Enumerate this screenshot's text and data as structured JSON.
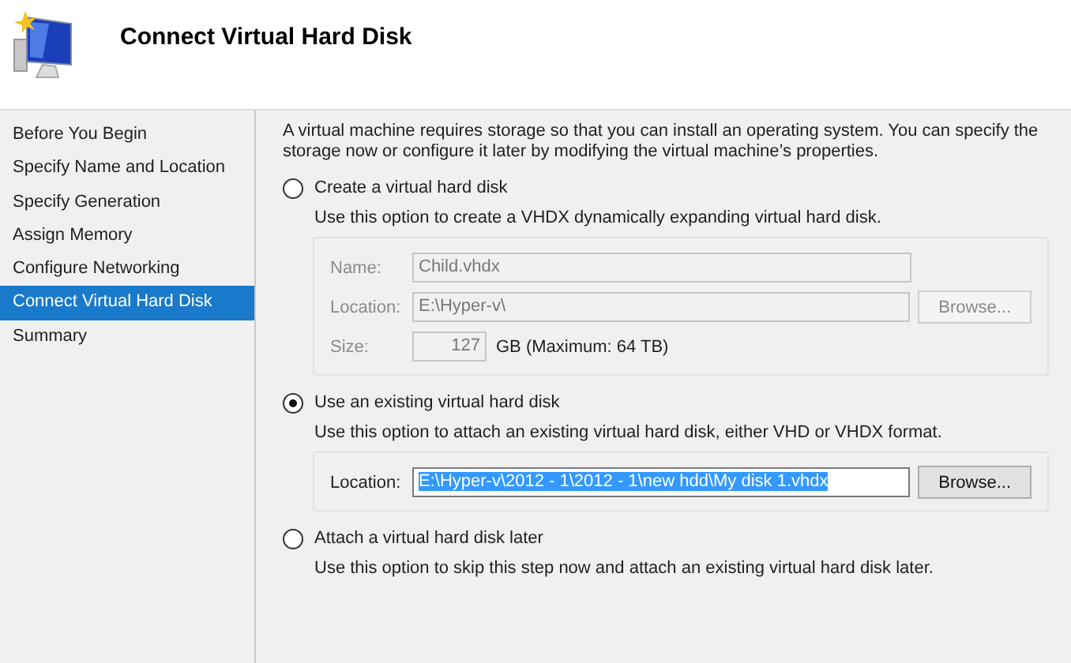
{
  "header": {
    "title": "Connect Virtual Hard Disk"
  },
  "sidebar": {
    "items": [
      {
        "label": "Before You Begin",
        "selected": false
      },
      {
        "label": "Specify Name and Location",
        "selected": false
      },
      {
        "label": "Specify Generation",
        "selected": false
      },
      {
        "label": "Assign Memory",
        "selected": false
      },
      {
        "label": "Configure Networking",
        "selected": false
      },
      {
        "label": "Connect Virtual Hard Disk",
        "selected": true
      },
      {
        "label": "Summary",
        "selected": false
      }
    ]
  },
  "intro": "A virtual machine requires storage so that you can install an operating system. You can specify the storage now or configure it later by modifying the virtual machine’s properties.",
  "options": [
    {
      "label": "Create a virtual hard disk",
      "selected": false,
      "description": "Use this option to create a VHDX dynamically expanding virtual hard disk.",
      "panel": {
        "disabled": true,
        "fields": [
          {
            "kind": "text",
            "label": "Name:",
            "value": "Child.vhdx"
          },
          {
            "kind": "browse",
            "label": "Location:",
            "value": "E:\\Hyper-v\\",
            "button": "Browse...",
            "text_selected": false
          },
          {
            "kind": "size",
            "label": "Size:",
            "value": "127",
            "unit": "GB (Maximum: 64 TB)"
          }
        ]
      }
    },
    {
      "label": "Use an existing virtual hard disk",
      "selected": true,
      "description": "Use this option to attach an existing virtual hard disk, either VHD or VHDX format.",
      "panel": {
        "disabled": false,
        "fields": [
          {
            "kind": "browse",
            "label": "Location:",
            "value": "E:\\Hyper-v\\2012 - 1\\2012 - 1\\new hdd\\My disk 1.vhdx",
            "button": "Browse...",
            "text_selected": true
          }
        ]
      }
    },
    {
      "label": "Attach a virtual hard disk later",
      "selected": false,
      "description": "Use this option to skip this step now and attach an existing virtual hard disk later."
    }
  ]
}
